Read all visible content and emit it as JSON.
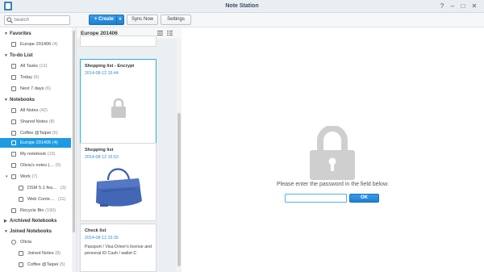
{
  "window": {
    "title": "Note Station",
    "help": "?",
    "minimize": "–",
    "maximize": "□",
    "close": "✕"
  },
  "toolbar": {
    "search_placeholder": "Search",
    "create_label": "+ Create",
    "create_caret": "▾",
    "sync_label": "Sync Now",
    "settings_label": "Settings"
  },
  "sidebar": {
    "sections": [
      {
        "label": "Favorites",
        "arrow": "▼"
      },
      {
        "label": "To-do List",
        "arrow": "▼"
      },
      {
        "label": "Notebooks",
        "arrow": "▼"
      },
      {
        "label": "Archived Notebooks",
        "arrow": "▶"
      },
      {
        "label": "Joined Notebooks",
        "arrow": "▼"
      }
    ],
    "items": [
      {
        "label": "Europe 201406",
        "count": "(4)",
        "icon": "notebook-icon"
      },
      {
        "label": "All Tasks",
        "count": "(12)",
        "icon": "task-list-icon"
      },
      {
        "label": "Today",
        "count": "(6)",
        "icon": "calendar-icon"
      },
      {
        "label": "Next 7 days",
        "count": "(6)",
        "icon": "calendar-icon"
      },
      {
        "label": "All Notes",
        "count": "(42)",
        "icon": "notes-icon"
      },
      {
        "label": "Shared Notes",
        "count": "(8)",
        "icon": "shared-notes-icon"
      },
      {
        "label": "Coffee @Taipei",
        "count": "(6)",
        "icon": "notebook-icon"
      },
      {
        "label": "Europe 201406",
        "count": "(4)",
        "icon": "notebook-icon"
      },
      {
        "label": "My notebook",
        "count": "(15)",
        "icon": "notebook-icon"
      },
      {
        "label": "Olivia's notes (…",
        "count": "(5)",
        "icon": "notebook-icon"
      },
      {
        "label": "Work",
        "count": "(7)",
        "icon": "notebook-stack-icon"
      },
      {
        "label": "DSM 5.1 fea…",
        "count": "(3)",
        "icon": "notebook-icon"
      },
      {
        "label": "Web Conte…",
        "count": "(11)",
        "icon": "notebook-icon"
      },
      {
        "label": "Recycle Bin",
        "count": "(190)",
        "icon": "trash-icon"
      },
      {
        "label": "Olivia",
        "count": "",
        "icon": "user-icon"
      },
      {
        "label": "Joined Notes",
        "count": "(8)",
        "icon": "notebook-icon"
      },
      {
        "label": "Coffee @Taipei",
        "count": "(5)",
        "icon": "notebook-icon"
      }
    ]
  },
  "notelist": {
    "title": "Europe 201406",
    "cards": [
      {
        "title": "Shopping list - Encrypt",
        "date": "2014-08-12 15:44",
        "body": ""
      },
      {
        "title": "Shopping list",
        "date": "2014-08-12 15:53",
        "body": ""
      },
      {
        "title": "Check list",
        "date": "2014-08-12 15:35",
        "body": "Passport / Visa Driver's license and personal ID Cash / wallet C"
      }
    ]
  },
  "detail": {
    "prompt": "Please enter the password in the field below:",
    "password_value": "",
    "ok_label": "OK"
  },
  "colors": {
    "accent": "#1e9be0",
    "selected_card_border": "#25b3d9",
    "date_text": "#2a8fd6"
  }
}
